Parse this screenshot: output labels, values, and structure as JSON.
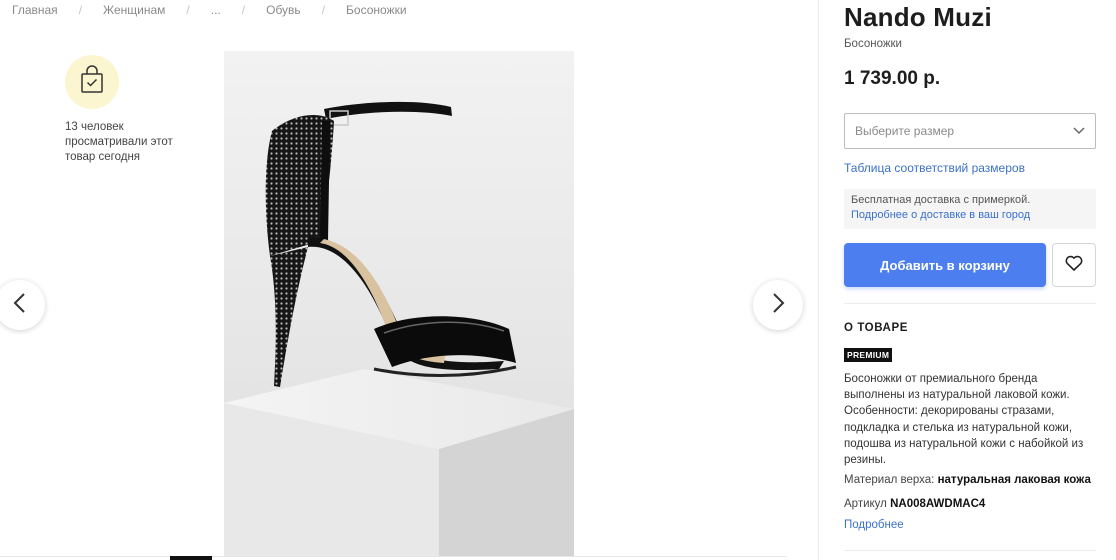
{
  "breadcrumb": {
    "items": [
      "Главная",
      "Женщинам",
      "...",
      "Обувь",
      "Босоножки"
    ],
    "separator": "/"
  },
  "views": {
    "icon": "shopping-bag-check-icon",
    "text": "13 человек просматривали этот товар сегодня"
  },
  "gallery": {
    "image_alt": "Nando Muzi Босоножки",
    "prev_icon": "chevron-left-icon",
    "next_icon": "chevron-right-icon"
  },
  "product": {
    "brand": "Nando Muzi",
    "category": "Босоножки",
    "price": "1 739.00 р."
  },
  "size": {
    "placeholder": "Выберите размер",
    "chart_link": "Таблица соответствий размеров"
  },
  "delivery": {
    "text": "Бесплатная доставка с примеркой.",
    "link": "Подробнее о доставке в ваш город"
  },
  "actions": {
    "add_to_cart": "Добавить в корзину",
    "wishlist_icon": "heart-icon"
  },
  "about": {
    "heading": "О ТОВАРЕ",
    "badge": "PREMIUM",
    "description": "Босоножки от премиального бренда выполнены из натуральной лаковой кожи. Особенности: декорированы стразами, подкладка и стелька из натуральной кожи, подошва из натуральной кожи с набойкой из резины.",
    "material_label": "Материал верха:",
    "material_value": "натуральная лаковая кожа",
    "sku_label": "Артикул",
    "sku_value": "NA008AWDMAC4",
    "more_link": "Подробнее"
  },
  "colors": {
    "accent": "#4c7ef0",
    "link": "#3b71c9",
    "badge_bg": "#fbf6cf"
  }
}
